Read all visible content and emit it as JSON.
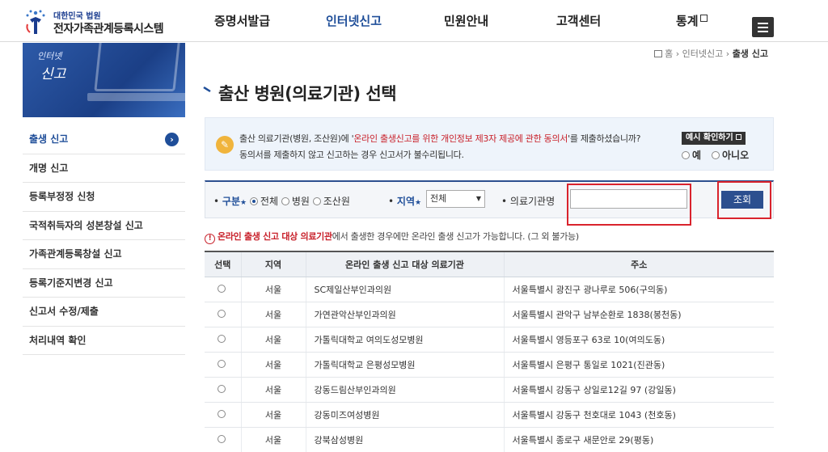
{
  "header": {
    "logo_small": "대한민국 법원",
    "logo_big": "전자가족관계등록시스템",
    "nav": [
      "증명서발급",
      "인터넷신고",
      "민원안내",
      "고객센터",
      "통계"
    ],
    "active_nav": "인터넷신고"
  },
  "sidebar": {
    "banner_line1": "인터넷",
    "banner_line2": "신고",
    "items": [
      {
        "label": "출생 신고",
        "active": true
      },
      {
        "label": "개명 신고"
      },
      {
        "label": "등록부정정 신청"
      },
      {
        "label": "국적취득자의 성본창설 신고"
      },
      {
        "label": "가족관계등록창설 신고"
      },
      {
        "label": "등록기준지변경 신고"
      },
      {
        "label": "신고서 수정/제출"
      },
      {
        "label": "처리내역 확인"
      }
    ],
    "active_arrow": "›"
  },
  "breadcrumb": {
    "home": "홈",
    "mid": "인터넷신고",
    "last": "출생 신고",
    "sep": "›"
  },
  "page_title": "출산 병원(의료기관) 선택",
  "notice": {
    "icon": "✎",
    "line1_pre": "출산 의료기관(병원, 조산원)에 '",
    "line1_red": "온라인 출생신고를 위한 개인정보 제3자 제공에 관한 동의서",
    "line1_post": "'를 제출하셨습니까?",
    "line2": "동의서를 제출하지 않고 신고하는 경우 신고서가 불수리됩니다.",
    "sample_btn": "예시 확인하기",
    "yes": "예",
    "no": "아니오"
  },
  "search": {
    "type_label": "구분",
    "type_options": [
      "전체",
      "병원",
      "조산원"
    ],
    "region_label": "지역",
    "region_value": "전체",
    "name_label": "의료기관명",
    "name_value": "",
    "button": "조회",
    "star": "★"
  },
  "warning": {
    "icon": "!",
    "red": "온라인 출생 신고 대상 의료기관",
    "rest": "에서 출생한 경우에만 온라인 출생 신고가 가능합니다. (그 외 불가능)"
  },
  "table": {
    "headers": [
      "선택",
      "지역",
      "온라인 출생 신고 대상 의료기관",
      "주소"
    ],
    "rows": [
      {
        "region": "서울",
        "name": "SC제일산부인과의원",
        "address": "서울특별시 광진구 광나루로 506(구의동)"
      },
      {
        "region": "서울",
        "name": "가연관악산부인과의원",
        "address": "서울특별시 관악구 남부순환로 1838(봉천동)"
      },
      {
        "region": "서울",
        "name": "가톨릭대학교 여의도성모병원",
        "address": "서울특별시 영등포구 63로 10(여의도동)"
      },
      {
        "region": "서울",
        "name": "가톨릭대학교 은평성모병원",
        "address": "서울특별시 은평구 통일로 1021(진관동)"
      },
      {
        "region": "서울",
        "name": "강동드림산부인과의원",
        "address": "서울특별시 강동구 상일로12길 97 (강일동)"
      },
      {
        "region": "서울",
        "name": "강동미즈여성병원",
        "address": "서울특별시 강동구 천호대로 1043 (천호동)"
      },
      {
        "region": "서울",
        "name": "강북삼성병원",
        "address": "서울특별시 종로구 새문안로 29(평동)"
      }
    ]
  },
  "colors": {
    "brand": "#1f4e99",
    "highlight": "#d9232d",
    "warning": "#c8202a"
  }
}
